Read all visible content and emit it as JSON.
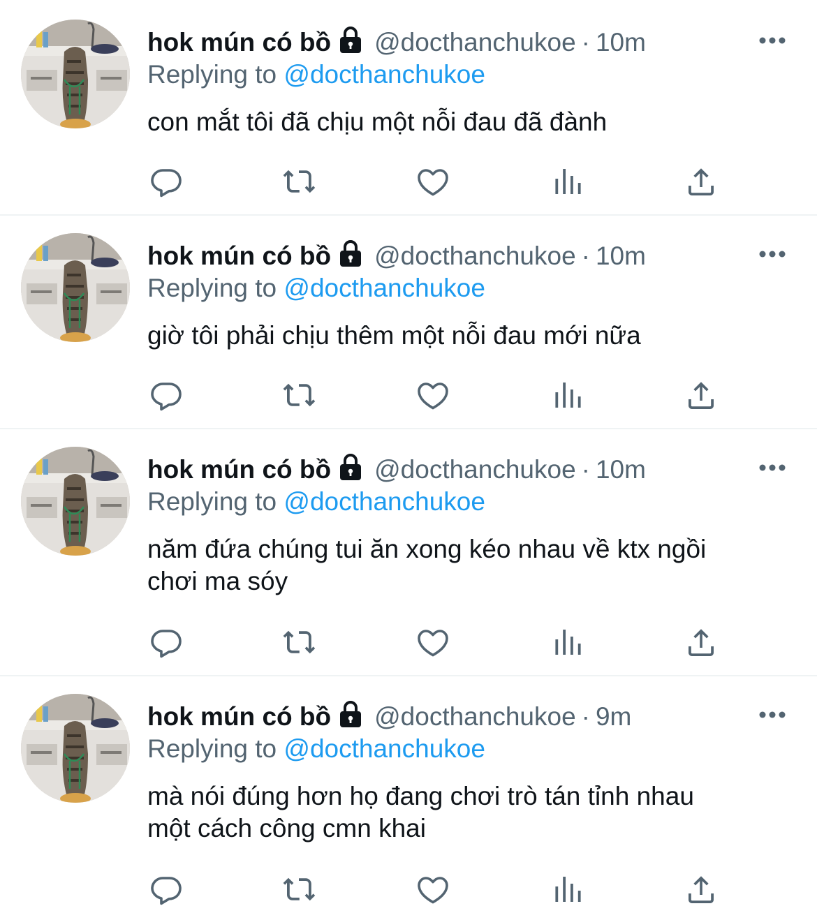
{
  "tweets": [
    {
      "name": "hok mún có bồ",
      "handle": "@docthanchukoe",
      "separator": "·",
      "time": "10m",
      "replying_prefix": "Replying to",
      "replying_to": "@docthanchukoe",
      "text": "con mắt tôi đã chịu một nỗi đau đã đành"
    },
    {
      "name": "hok mún có bồ",
      "handle": "@docthanchukoe",
      "separator": "·",
      "time": "10m",
      "replying_prefix": "Replying to",
      "replying_to": "@docthanchukoe",
      "text": "giờ tôi phải chịu thêm một nỗi đau mới nữa"
    },
    {
      "name": "hok mún có bồ",
      "handle": "@docthanchukoe",
      "separator": "·",
      "time": "10m",
      "replying_prefix": "Replying to",
      "replying_to": "@docthanchukoe",
      "text_lines": [
        "năm đứa chúng tui ăn xong kéo nhau về ktx ngồi",
        "chơi ma sóy"
      ]
    },
    {
      "name": "hok mún có bồ",
      "handle": "@docthanchukoe",
      "separator": "·",
      "time": "9m",
      "replying_prefix": "Replying to",
      "replying_to": "@docthanchukoe",
      "text_lines": [
        "mà nói đúng hơn họ đang chơi trò tán tỉnh nhau",
        "một cách công cmn khai"
      ]
    }
  ],
  "icons": {
    "reply": "reply-icon",
    "retweet": "retweet-icon",
    "like": "like-icon",
    "views": "views-icon",
    "share": "share-icon",
    "more": "more-icon",
    "lock": "lock-icon"
  },
  "colors": {
    "text": "#0f1419",
    "secondary": "#536471",
    "mention": "#1d9bf0",
    "divider": "#eff3f4"
  }
}
